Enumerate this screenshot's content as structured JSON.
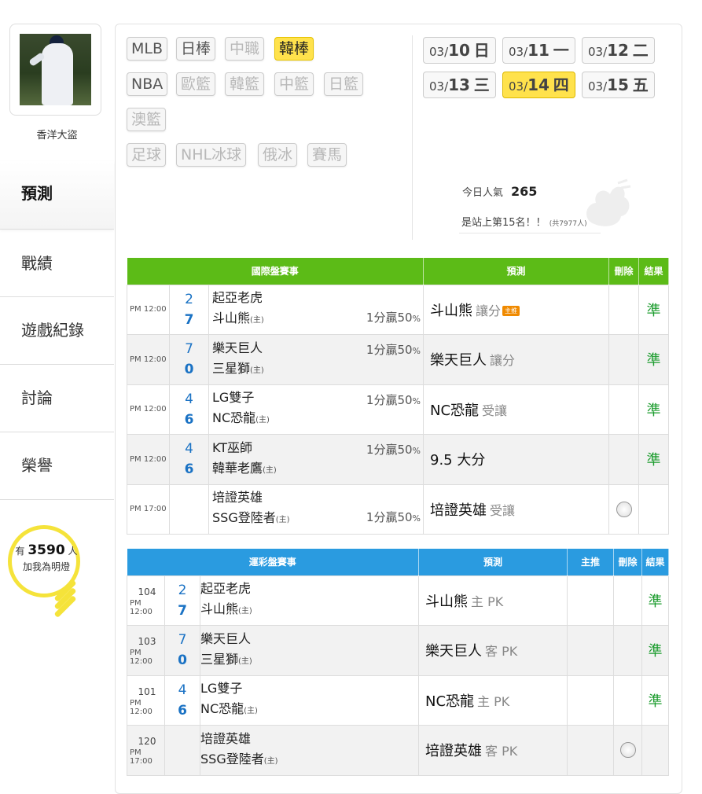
{
  "user": {
    "name": "香洋大盜"
  },
  "nav": [
    "預測",
    "戰績",
    "遊戲紀錄",
    "討論",
    "榮譽"
  ],
  "fans": {
    "prefix": "有",
    "count": "3590",
    "unit": "人",
    "caption": "加我為明燈"
  },
  "leagues": [
    "MLB",
    "日棒",
    "中職",
    "韓棒",
    "NBA",
    "歐籃",
    "韓籃",
    "中籃",
    "日籃",
    "澳籃",
    "足球",
    "NHL冰球",
    "俄冰",
    "賽馬"
  ],
  "dates": [
    {
      "md": "03/",
      "d": "10",
      "wd": "日"
    },
    {
      "md": "03/",
      "d": "11",
      "wd": "一"
    },
    {
      "md": "03/",
      "d": "12",
      "wd": "二"
    },
    {
      "md": "03/",
      "d": "13",
      "wd": "三"
    },
    {
      "md": "03/",
      "d": "14",
      "wd": "四"
    },
    {
      "md": "03/",
      "d": "15",
      "wd": "五"
    }
  ],
  "popularity": {
    "label": "今日人氣",
    "value": "265",
    "rank_text": "是站上第15名！！",
    "total": "(共7977人)"
  },
  "intl": {
    "headers": [
      "國際盤賽事",
      "預測",
      "刪除",
      "結果"
    ],
    "rows": [
      {
        "time": "PM 12:00",
        "s1": "2",
        "s2": "7",
        "t1": "起亞老虎",
        "t2": "斗山熊",
        "home": "(主)",
        "odds": "1分贏50",
        "pct": "%",
        "pred": "斗山熊",
        "pred_sub": "讓分",
        "badge": "主推",
        "result": "準"
      },
      {
        "time": "PM 12:00",
        "s1": "7",
        "s2": "0",
        "t1": "樂天巨人",
        "t2": "三星獅",
        "home": "(主)",
        "odds": "1分贏50",
        "pct": "%",
        "pred": "樂天巨人",
        "pred_sub": "讓分",
        "result": "準"
      },
      {
        "time": "PM 12:00",
        "s1": "4",
        "s2": "6",
        "t1": "LG雙子",
        "t2": "NC恐龍",
        "home": "(主)",
        "odds": "1分贏50",
        "pct": "%",
        "pred": "NC恐龍",
        "pred_sub": "受讓",
        "result": "準"
      },
      {
        "time": "PM 12:00",
        "s1": "4",
        "s2": "6",
        "t1": "KT巫師",
        "t2": "韓華老鷹",
        "home": "(主)",
        "odds": "1分贏50",
        "pct": "%",
        "pred": "9.5 大分",
        "pred_sub": "",
        "result": "準"
      },
      {
        "time": "PM 17:00",
        "s1": "",
        "s2": "",
        "t1": "培證英雄",
        "t2": "SSG登陸者",
        "home": "(主)",
        "odds": "1分贏50",
        "pct": "%",
        "pred": "培證英雄",
        "pred_sub": "受讓",
        "result": ""
      }
    ]
  },
  "lottery": {
    "headers": [
      "運彩盤賽事",
      "預測",
      "主推",
      "刪除",
      "結果"
    ],
    "rows": [
      {
        "no": "104",
        "time": "PM 12:00",
        "s1": "2",
        "s2": "7",
        "t1": "起亞老虎",
        "t2": "斗山熊",
        "home": "(主)",
        "pred": "斗山熊",
        "pred_sub": "主 PK",
        "result": "準"
      },
      {
        "no": "103",
        "time": "PM 12:00",
        "s1": "7",
        "s2": "0",
        "t1": "樂天巨人",
        "t2": "三星獅",
        "home": "(主)",
        "pred": "樂天巨人",
        "pred_sub": "客 PK",
        "result": "準"
      },
      {
        "no": "101",
        "time": "PM 12:00",
        "s1": "4",
        "s2": "6",
        "t1": "LG雙子",
        "t2": "NC恐龍",
        "home": "(主)",
        "pred": "NC恐龍",
        "pred_sub": "主 PK",
        "result": "準"
      },
      {
        "no": "120",
        "time": "PM 17:00",
        "s1": "",
        "s2": "",
        "t1": "培證英雄",
        "t2": "SSG登陸者",
        "home": "(主)",
        "pred": "培證英雄",
        "pred_sub": "客 PK",
        "result": ""
      }
    ]
  },
  "colors": {
    "intl_header": "#5cbb17",
    "lottery_header": "#2a9be0",
    "selected": "#ffe24c",
    "result": "#1c9c2e"
  }
}
